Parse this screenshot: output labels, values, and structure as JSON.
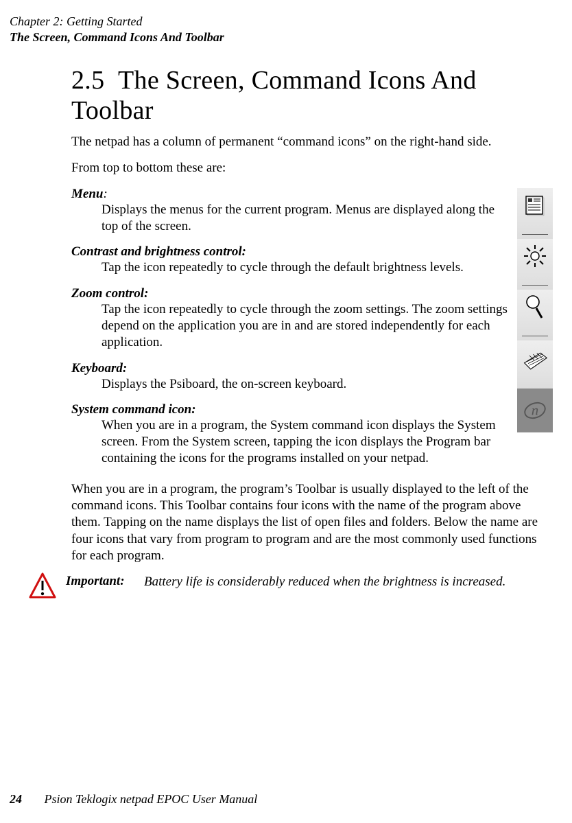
{
  "runningHead": {
    "chapter": "Chapter 2:  Getting Started",
    "section": "The Screen, Command Icons And Toolbar"
  },
  "heading": {
    "number": "2.5",
    "title": "The Screen, Command Icons And Toolbar"
  },
  "intro1": "The netpad has a column of permanent “command icons” on the right-hand side.",
  "intro2": "From top to bottom these are:",
  "defs": {
    "menu": {
      "term": "Menu",
      "colon": ":",
      "body": "Displays the menus for the current program. Menus are displayed along the top of the screen."
    },
    "contrast": {
      "term": "Contrast and brightness control:",
      "body": "Tap the icon repeatedly to cycle through the default brightness levels."
    },
    "zoom": {
      "term": "Zoom control:",
      "body": "Tap the icon repeatedly to cycle through the zoom settings. The zoom settings depend on the application you are in and are stored independently for each application."
    },
    "keyboard": {
      "term": "Keyboard:",
      "body": "Displays the Psiboard, the on-screen keyboard."
    },
    "system": {
      "term": "System command icon:",
      "body": "When you are in a program, the System command icon displays the System screen. From the System screen, tapping the icon displays the Program bar containing the icons for the programs installed on your netpad."
    }
  },
  "tail": "When you are in a program, the program’s Toolbar is usually displayed to the left of the command icons. This Toolbar contains four icons with the name of the program above them. Tapping on the name displays the list of open files and folders. Below the name are four icons that vary from program to program and are the most commonly used functions for each program.",
  "important": {
    "label": "Important:",
    "body": "Battery life is considerably reduced when the brightness is increased."
  },
  "footer": {
    "page": "24",
    "manual": "Psion Teklogix netpad EPOC User Manual"
  }
}
